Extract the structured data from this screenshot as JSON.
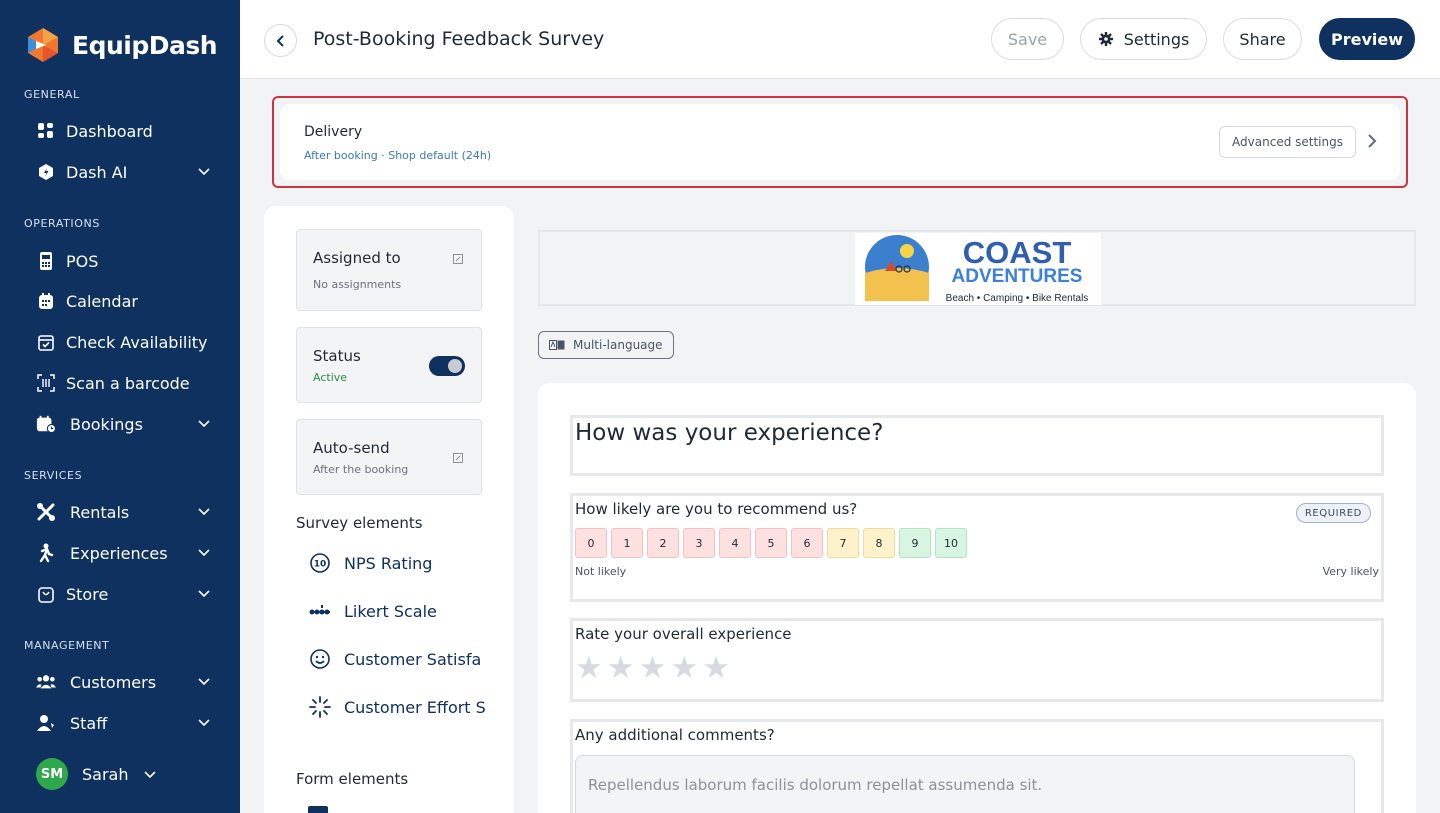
{
  "brand": {
    "name": "EquipDash"
  },
  "sidebar": {
    "sections": {
      "general": "GENERAL",
      "operations": "OPERATIONS",
      "services": "SERVICES",
      "management": "MANAGEMENT"
    },
    "items": [
      {
        "label": "Dashboard",
        "icon": "dashboard-icon"
      },
      {
        "label": "Dash AI",
        "icon": "dash-ai-icon"
      },
      {
        "label": "POS",
        "icon": "pos-icon"
      },
      {
        "label": "Calendar",
        "icon": "calendar-icon"
      },
      {
        "label": "Check Availability",
        "icon": "check-availability-icon"
      },
      {
        "label": "Scan a barcode",
        "icon": "barcode-icon"
      },
      {
        "label": "Bookings",
        "icon": "bookings-icon"
      },
      {
        "label": "Rentals",
        "icon": "rentals-icon"
      },
      {
        "label": "Experiences",
        "icon": "experiences-icon"
      },
      {
        "label": "Store",
        "icon": "store-icon"
      },
      {
        "label": "Customers",
        "icon": "customers-icon"
      },
      {
        "label": "Staff",
        "icon": "staff-icon"
      }
    ],
    "user": {
      "initials": "SM",
      "name": "Sarah"
    }
  },
  "header": {
    "title": "Post-Booking Feedback Survey",
    "save_label": "Save",
    "settings_label": "Settings",
    "share_label": "Share",
    "preview_label": "Preview"
  },
  "delivery": {
    "title": "Delivery",
    "subtitle": "After booking · Shop default (24h)",
    "advanced_label": "Advanced settings"
  },
  "panel": {
    "assigned": {
      "title": "Assigned to",
      "sub": "No assignments"
    },
    "status": {
      "title": "Status",
      "sub": "Active",
      "enabled": true
    },
    "autosend": {
      "title": "Auto-send",
      "sub": "After the booking"
    },
    "survey_elements_heading": "Survey elements",
    "survey_elements": [
      {
        "label": "NPS Rating",
        "icon": "nps-icon"
      },
      {
        "label": "Likert Scale",
        "icon": "likert-icon"
      },
      {
        "label": "Customer Satisfa",
        "icon": "smile-icon"
      },
      {
        "label": "Customer Effort S",
        "icon": "effort-icon"
      }
    ],
    "form_elements_heading": "Form elements"
  },
  "logo": {
    "line1": "COAST",
    "line2": "ADVENTURES",
    "tagline": "Beach • Camping • Bike Rentals"
  },
  "multilang_label": "Multi-language",
  "survey": {
    "heading": "How was your experience?",
    "nps": {
      "question": "How likely are you to recommend us?",
      "required_label": "REQUIRED",
      "scale": [
        "0",
        "1",
        "2",
        "3",
        "4",
        "5",
        "6",
        "7",
        "8",
        "9",
        "10"
      ],
      "low_label": "Not likely",
      "high_label": "Very likely"
    },
    "rating": {
      "question": "Rate your overall experience",
      "stars": 5
    },
    "comments": {
      "question": "Any additional comments?",
      "placeholder": "Repellendus laborum facilis dolorum repellat assumenda sit."
    }
  },
  "colors": {
    "sidebar": "#0e3160",
    "highlight_border": "#d0333e",
    "active_green": "#2ea84a"
  }
}
